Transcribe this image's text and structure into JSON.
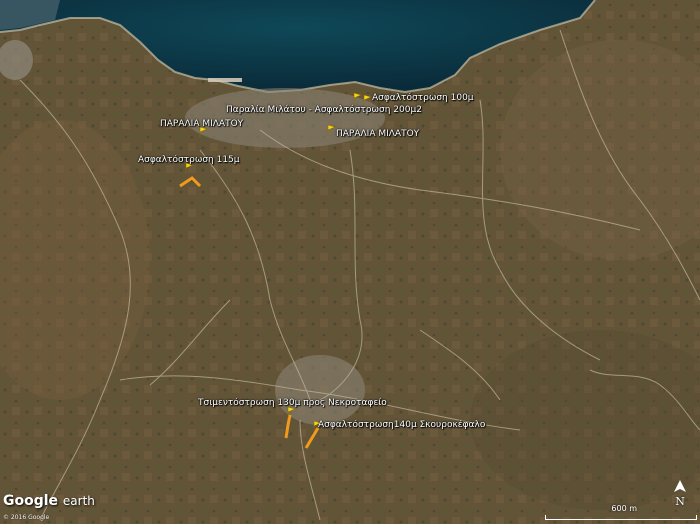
{
  "colors": {
    "sea": "#0d3a4a",
    "land": "#6b5a3c",
    "marker": "#f6d31a",
    "route": "#f29a1c"
  },
  "labels": [
    {
      "id": "asfalt-100m",
      "text": "Ασφαλτόστρωση 100μ"
    },
    {
      "id": "paralia-milatou-asfalt",
      "text": "Παραλία Μιλάτου - Ασφαλτόστρωση 200μ2"
    },
    {
      "id": "paralia-milatou-left",
      "text": "ΠΑΡΑΛΙΑ ΜΙΛΑΤΟΥ"
    },
    {
      "id": "paralia-milatou-right",
      "text": "ΠΑΡΑΛΙΑ ΜΙΛΑΤΟΥ"
    },
    {
      "id": "asfalt-115m",
      "text": "Ασφαλτόστρωση 115μ"
    },
    {
      "id": "tsimento-130m",
      "text": "Τσιμεντόστρωση 130μ προς Νεκροταφείο"
    },
    {
      "id": "asfalt-140m",
      "text": "Ασφαλτόστρωση140μ Σκουροκέφαλο"
    }
  ],
  "branding": {
    "google": "Google",
    "earth": "earth",
    "copyright": "© 2016 Google"
  },
  "compass": {
    "label": "N"
  },
  "scale": {
    "label": "600 m"
  }
}
